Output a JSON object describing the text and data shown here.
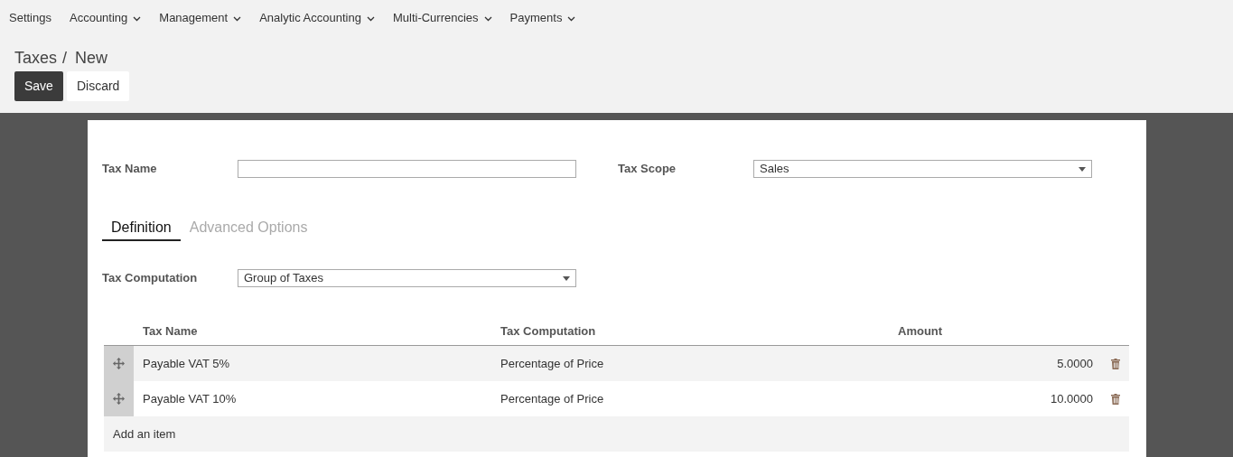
{
  "menu": [
    {
      "label": "Settings",
      "dropdown": false
    },
    {
      "label": "Accounting",
      "dropdown": true
    },
    {
      "label": "Management",
      "dropdown": true
    },
    {
      "label": "Analytic Accounting",
      "dropdown": true
    },
    {
      "label": "Multi-Currencies",
      "dropdown": true
    },
    {
      "label": "Payments",
      "dropdown": true
    }
  ],
  "breadcrumb": {
    "parent": "Taxes",
    "separator": "/",
    "current": "New"
  },
  "buttons": {
    "save": "Save",
    "discard": "Discard"
  },
  "form": {
    "tax_name": {
      "label": "Tax Name"
    },
    "tax_scope": {
      "label": "Tax Scope",
      "value": "Sales"
    }
  },
  "tabs": [
    {
      "label": "Definition",
      "selected": true
    },
    {
      "label": "Advanced Options",
      "selected": false
    }
  ],
  "tax_computation": {
    "label": "Tax Computation",
    "value": "Group of Taxes"
  },
  "table": {
    "columns": [
      "Tax Name",
      "Tax Computation",
      "Amount"
    ],
    "rows": [
      {
        "name": "Payable VAT 5%",
        "computation": "Percentage of Price",
        "amount": "5.0000"
      },
      {
        "name": "Payable VAT 10%",
        "computation": "Percentage of Price",
        "amount": "10.0000"
      }
    ],
    "add_item": "Add an item"
  }
}
